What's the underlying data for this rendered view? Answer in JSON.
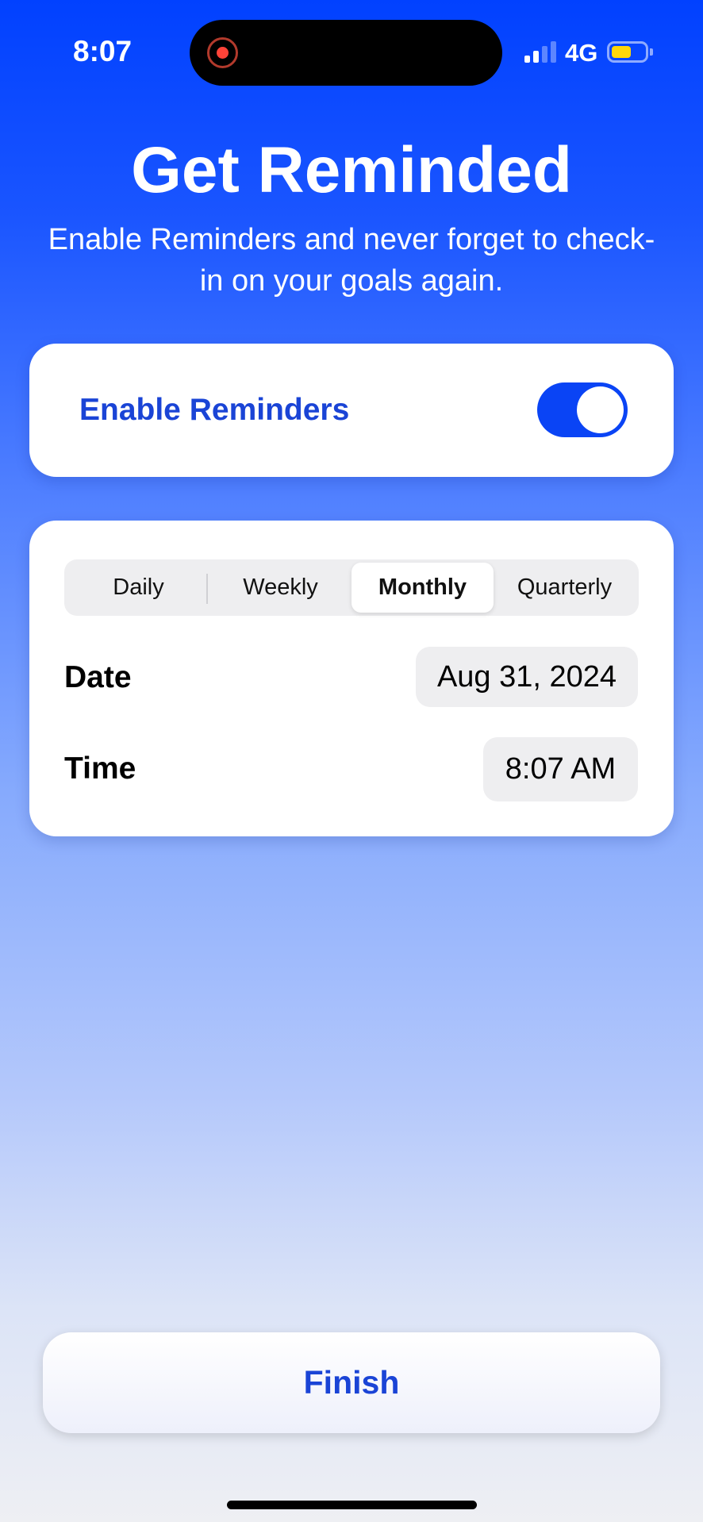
{
  "status_bar": {
    "time": "8:07",
    "network": "4G",
    "signal_bars": 2,
    "battery_level": 0.5,
    "battery_color": "#ffd60a",
    "recording_indicator": "screen-recording-icon"
  },
  "header": {
    "title": "Get Reminded",
    "subtitle": "Enable Reminders and never forget to check-in on your goals again."
  },
  "reminders": {
    "label": "Enable Reminders",
    "enabled": true,
    "accent": "#0a44f5"
  },
  "schedule": {
    "frequencies": [
      "Daily",
      "Weekly",
      "Monthly",
      "Quarterly"
    ],
    "selected": "Monthly",
    "date_label": "Date",
    "date_value": "Aug 31, 2024",
    "time_label": "Time",
    "time_value": "8:07 AM"
  },
  "finish_label": "Finish"
}
